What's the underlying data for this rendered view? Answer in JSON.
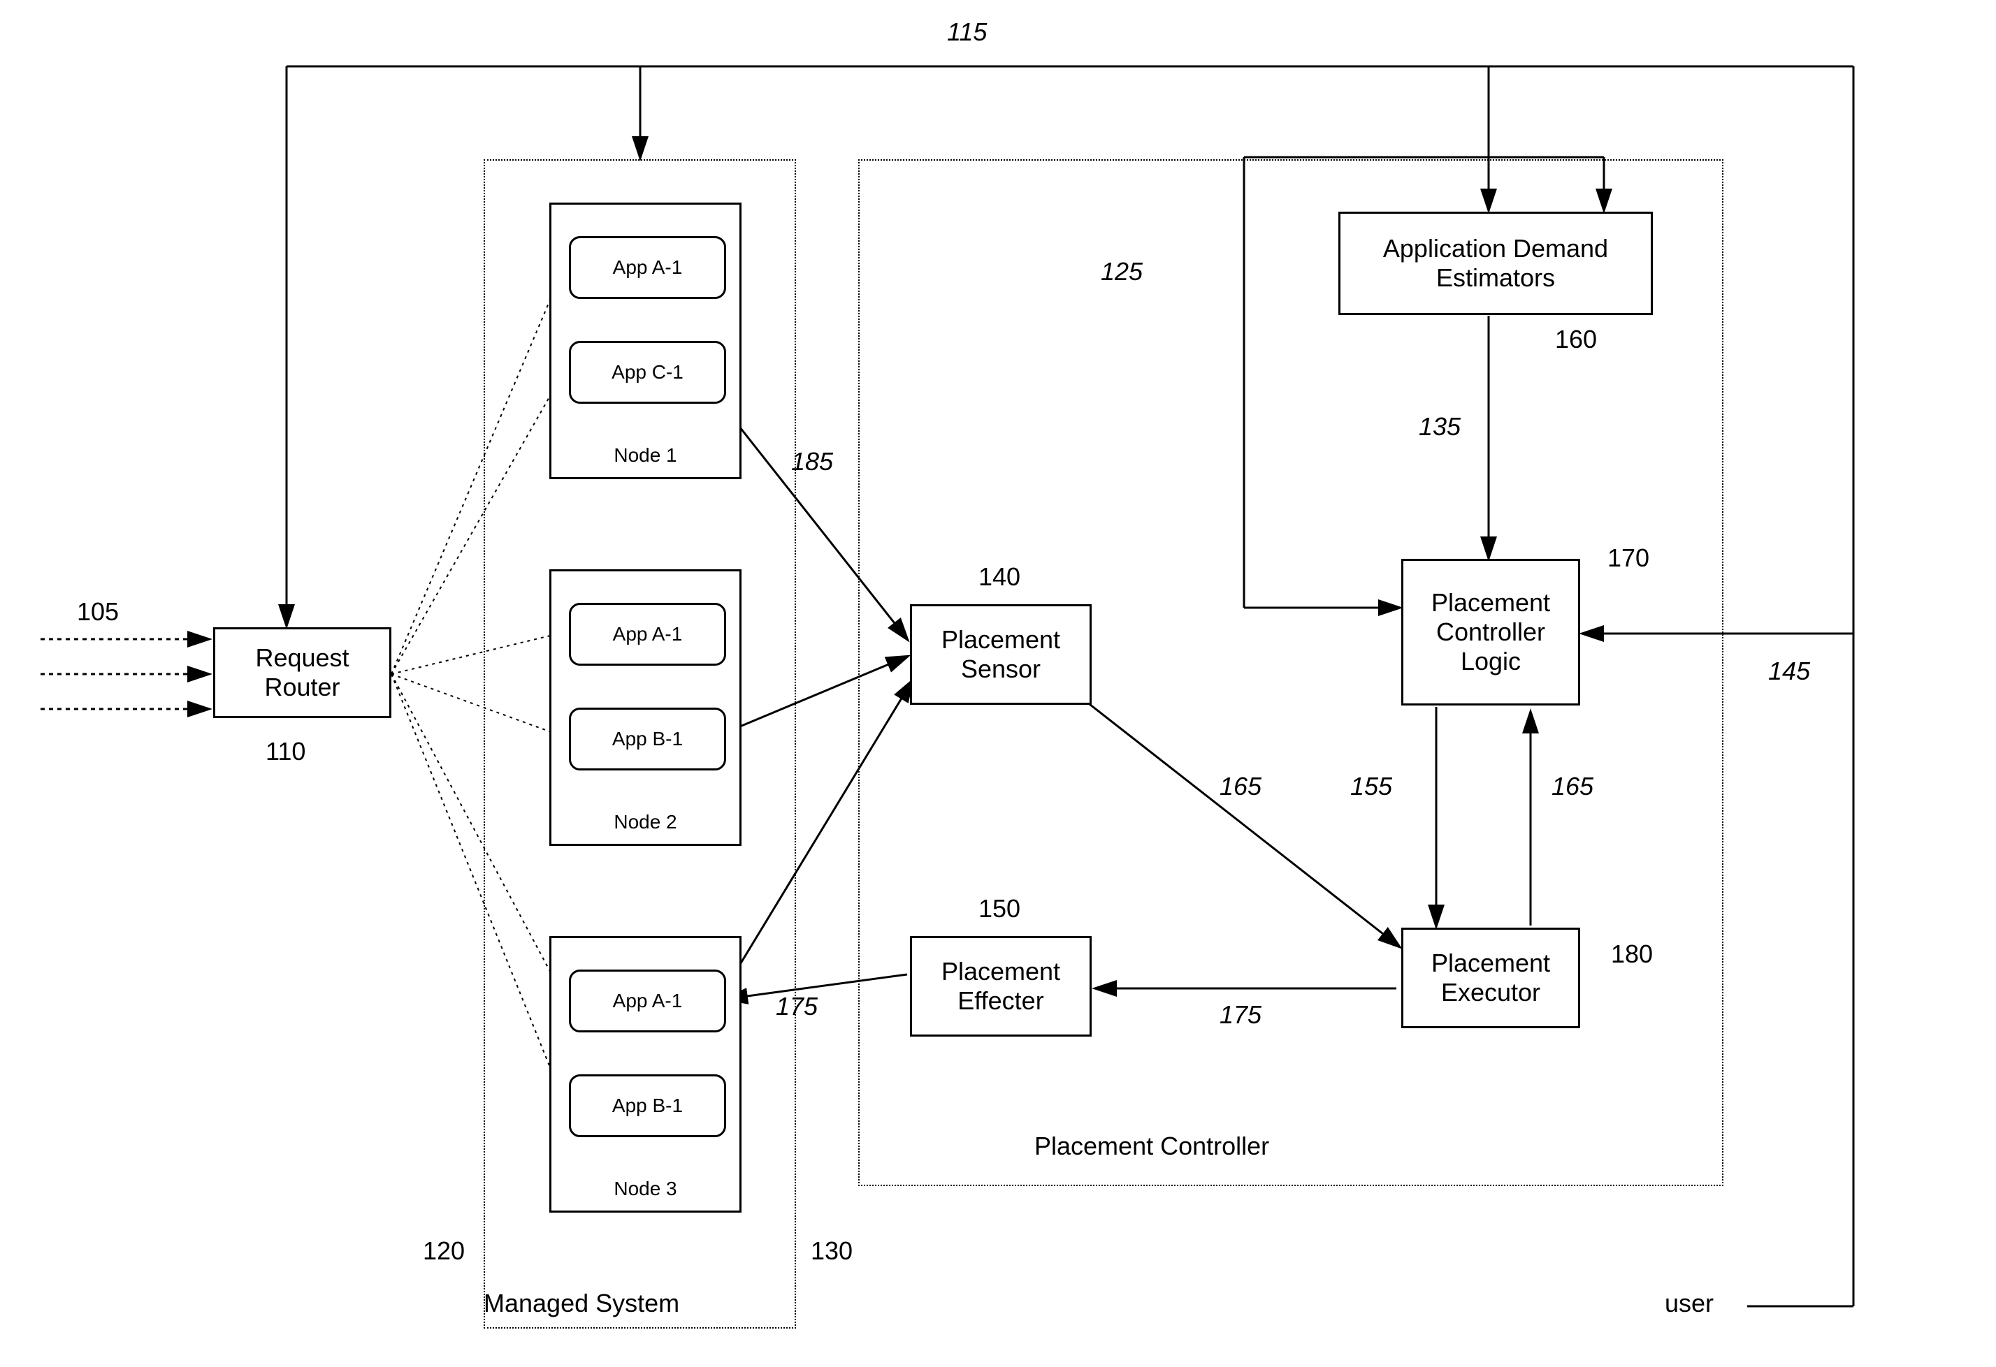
{
  "boxes": {
    "request_router": "Request\nRouter",
    "app_demand_est": "Application Demand\nEstimators",
    "placement_sensor": "Placement\nSensor",
    "placement_effecter": "Placement\nEffecter",
    "placement_controller_logic": "Placement\nController\nLogic",
    "placement_executor": "Placement\nExecutor"
  },
  "apps": {
    "node1_app1": "App A-1",
    "node1_app2": "App C-1",
    "node2_app1": "App A-1",
    "node2_app2": "App B-1",
    "node3_app1": "App A-1",
    "node3_app2": "App B-1"
  },
  "nodes": {
    "node1": "Node 1",
    "node2": "Node 2",
    "node3": "Node 3"
  },
  "labels": {
    "l105": "105",
    "l110": "110",
    "l115": "115",
    "l120": "120",
    "l125": "125",
    "l130": "130",
    "l135": "135",
    "l140": "140",
    "l145": "145",
    "l150": "150",
    "l155": "155",
    "l160": "160",
    "l165a": "165",
    "l165b": "165",
    "l170": "170",
    "l175a": "175",
    "l175b": "175",
    "l180": "180",
    "l185": "185",
    "managed_system": "Managed System",
    "placement_controller": "Placement Controller",
    "user": "user"
  }
}
